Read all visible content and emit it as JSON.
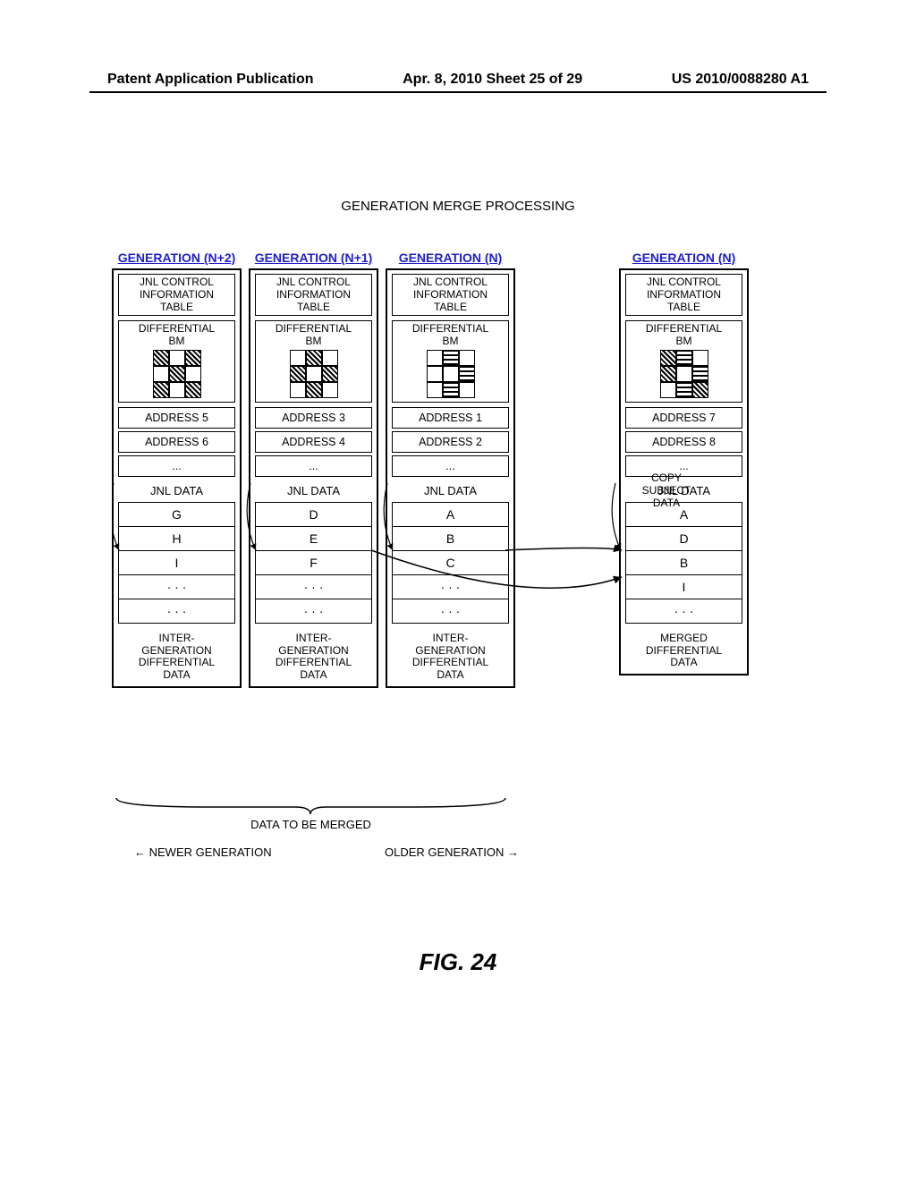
{
  "header": {
    "left": "Patent Application Publication",
    "center": "Apr. 8, 2010  Sheet 25 of 29",
    "right": "US 2010/0088280 A1"
  },
  "title": "GENERATION MERGE PROCESSING",
  "columns": [
    {
      "gen_label": "GENERATION (N+2)",
      "jnl_ctrl": "JNL CONTROL\nINFORMATION\nTABLE",
      "bm_label": "DIFFERENTIAL\nBM",
      "bm_pattern": [
        "h",
        "",
        "h",
        "",
        "h",
        "",
        "h",
        "",
        "h"
      ],
      "addresses": [
        "ADDRESS 5",
        "ADDRESS 6",
        "..."
      ],
      "jnl_title": "JNL DATA",
      "data": [
        "G",
        "H",
        "I",
        "· · ·",
        "· · ·"
      ],
      "footer": "INTER-\nGENERATION\nDIFFERENTIAL\nDATA"
    },
    {
      "gen_label": "GENERATION (N+1)",
      "jnl_ctrl": "JNL CONTROL\nINFORMATION\nTABLE",
      "bm_label": "DIFFERENTIAL\nBM",
      "bm_pattern": [
        "",
        "h",
        "",
        "h",
        "",
        "h",
        "",
        "h",
        ""
      ],
      "addresses": [
        "ADDRESS 3",
        "ADDRESS 4",
        "..."
      ],
      "jnl_title": "JNL DATA",
      "data": [
        "D",
        "E",
        "F",
        "· · ·",
        "· · ·"
      ],
      "footer": "INTER-\nGENERATION\nDIFFERENTIAL\nDATA"
    },
    {
      "gen_label": "GENERATION (N)",
      "jnl_ctrl": "JNL CONTROL\nINFORMATION\nTABLE",
      "bm_label": "DIFFERENTIAL\nBM",
      "bm_pattern": [
        "",
        "v",
        "",
        "",
        "",
        "v",
        "",
        "v",
        ""
      ],
      "addresses": [
        "ADDRESS 1",
        "ADDRESS 2",
        "..."
      ],
      "jnl_title": "JNL DATA",
      "data": [
        "A",
        "B",
        "C",
        "· · ·",
        "· · ·"
      ],
      "footer": "INTER-\nGENERATION\nDIFFERENTIAL\nDATA"
    },
    {
      "gen_label": "GENERATION (N)",
      "jnl_ctrl": "JNL CONTROL\nINFORMATION\nTABLE",
      "bm_label": "DIFFERENTIAL\nBM",
      "bm_pattern": [
        "h",
        "v",
        "",
        "h",
        "",
        "v",
        "",
        "v",
        "h"
      ],
      "addresses": [
        "ADDRESS 7",
        "ADDRESS 8",
        "..."
      ],
      "jnl_title": "JNL DATA",
      "data": [
        "A",
        "D",
        "B",
        "I",
        "· · ·"
      ],
      "footer": "MERGED\nDIFFERENTIAL\nDATA"
    }
  ],
  "copy_subject": "COPY\nSUBJECT\nDATA",
  "brace_label": "DATA TO BE MERGED",
  "newer": "←  NEWER GENERATION",
  "older": "OLDER GENERATION  →",
  "figure": "FIG. 24"
}
